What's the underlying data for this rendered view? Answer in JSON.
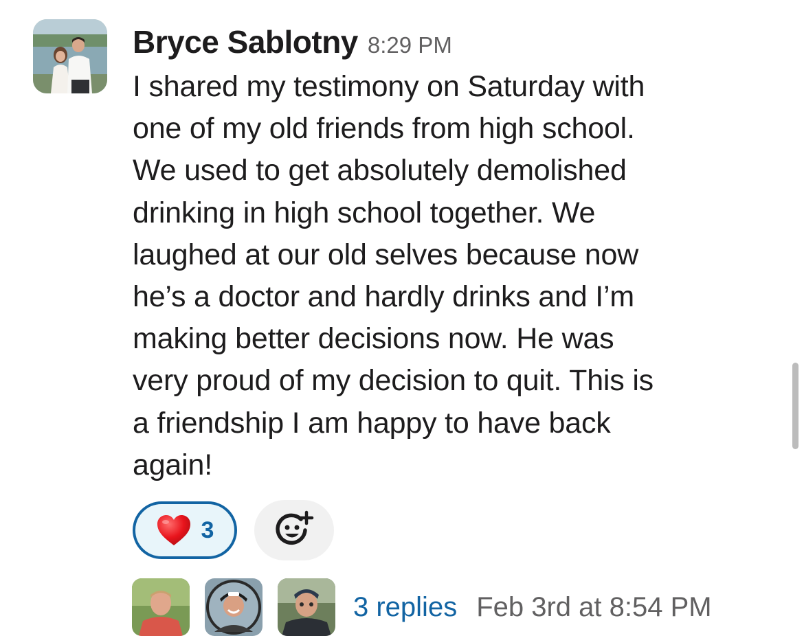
{
  "message": {
    "author": "Bryce Sablotny",
    "timestamp": "8:29 PM",
    "lines": [
      "I shared my testimony on Saturday with",
      "one of my old friends from high school.",
      "We used to get absolutely demolished",
      "drinking in high school together. We",
      "laughed at our old selves because now",
      "he’s a doctor and hardly drinks and I’m",
      "making better decisions now. He was",
      "very proud of my decision to quit. This is",
      "a friendship I am happy to have back",
      "again!"
    ]
  },
  "reactions": [
    {
      "emoji": "heart-icon",
      "count": "3",
      "selected": true
    }
  ],
  "add_reaction": {
    "icon": "add-reaction-icon"
  },
  "thread": {
    "replies_label": "3 replies",
    "last_reply": "Feb 3rd at 8:54 PM",
    "participants": [
      "participant-avatar-1",
      "participant-avatar-2",
      "participant-avatar-3"
    ]
  },
  "colors": {
    "link": "#1264a3",
    "muted": "#616061",
    "text": "#1d1c1d",
    "reaction_bg": "#e8f5fa"
  }
}
